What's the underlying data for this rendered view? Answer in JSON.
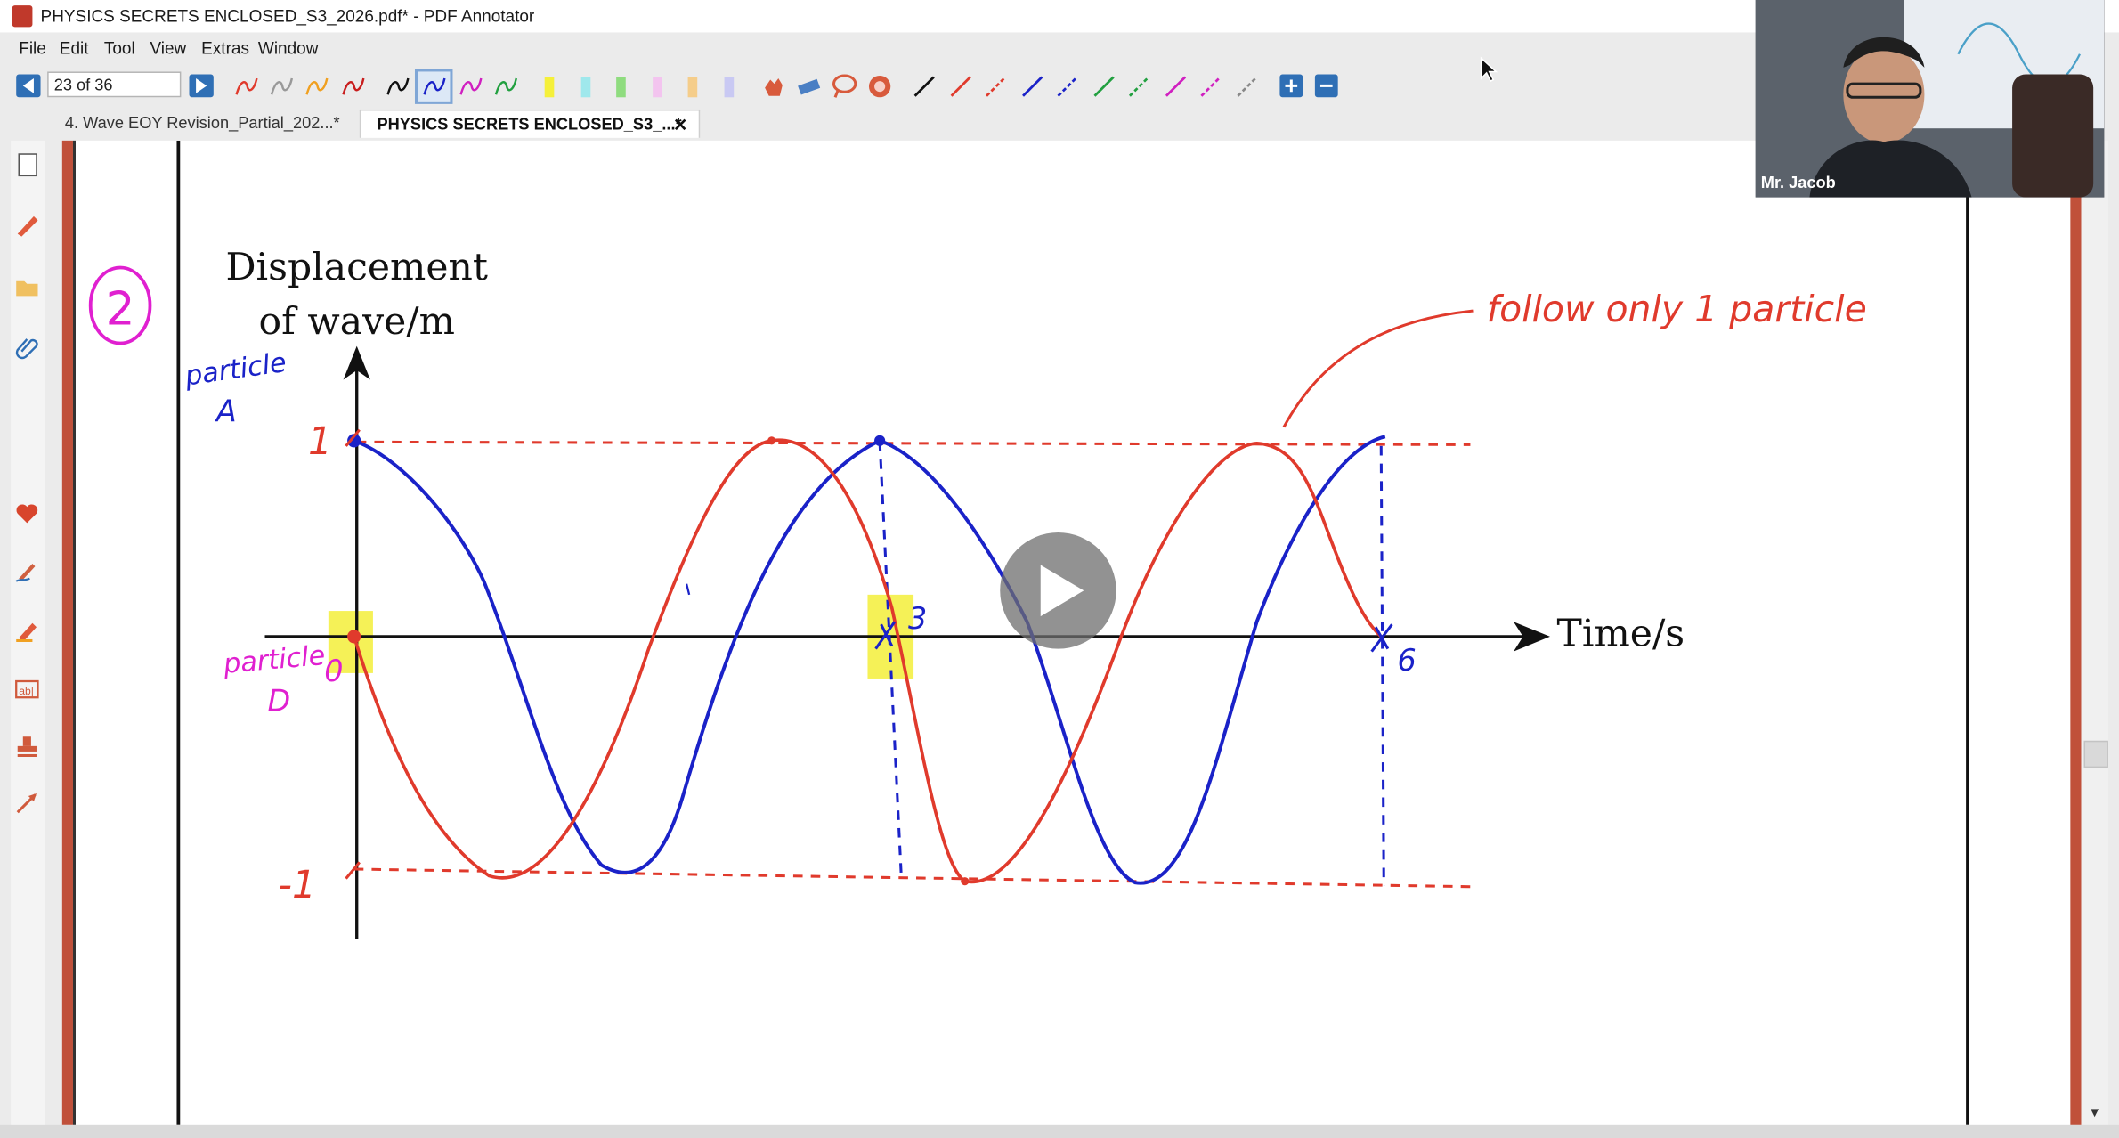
{
  "window": {
    "title": "PHYSICS SECRETS ENCLOSED_S3_2026.pdf* - PDF Annotator"
  },
  "menu": {
    "items": [
      "File",
      "Edit",
      "Tool",
      "View",
      "Extras",
      "Window"
    ]
  },
  "toolbar": {
    "page_indicator": "23 of 36"
  },
  "tabs": [
    {
      "label": "4. Wave EOY Revision_Partial_202...*",
      "active": false
    },
    {
      "label": "PHYSICS SECRETS ENCLOSED_S3_...*",
      "active": true,
      "close": "✕"
    }
  ],
  "webcam": {
    "name": "Mr. Jacob"
  },
  "colors": {
    "annotation_red": "#e03a2c",
    "annotation_blue": "#1a22c8",
    "annotation_magenta": "#e020d0",
    "highlight_yellow": "#f3ee3a",
    "frame_red": "#c0503a"
  },
  "figure": {
    "question_number": "2",
    "y_axis_label_line1": "Displacement",
    "y_axis_label_line2": "of wave/m",
    "x_axis_label": "Time/s",
    "y_tick_top": "1",
    "y_tick_bottom": "-1",
    "origin_label": "0",
    "x_tick_3": "3",
    "x_tick_6": "6",
    "particle_a_line1": "particle",
    "particle_a_line2": "A",
    "particle_d_line1": "particle",
    "particle_d_line2": "D",
    "note": "follow only 1 particle"
  }
}
